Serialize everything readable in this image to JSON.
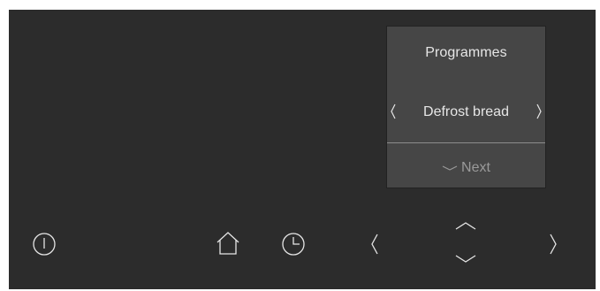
{
  "display": {
    "title": "Programmes",
    "selection": "Defrost bread",
    "next_label": "Next"
  },
  "icons": {
    "power": "power-icon",
    "home": "home-icon",
    "timer": "clock-icon",
    "left": "chevron-left-icon",
    "right": "chevron-right-icon",
    "up": "chevron-up-icon",
    "down": "chevron-down-icon"
  },
  "colors": {
    "panel": "#2c2c2c",
    "display": "#464646",
    "text": "#e6e6e6",
    "muted": "#9a9a9a"
  }
}
